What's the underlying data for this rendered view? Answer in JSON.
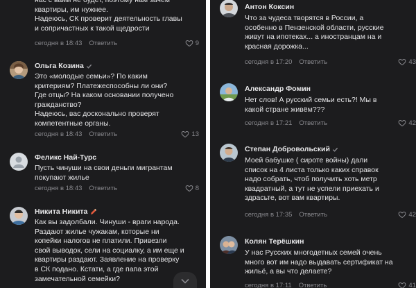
{
  "left": {
    "comments": [
      {
        "author": "",
        "text": "нас с вами не будет, поэтому нам зачем\nквартиры, им нужнее.\nНадеюсь, СК проверит деятельность главы\nи сопричастных к такой щедрости",
        "time": "сегодня в 18:43",
        "reply": "Ответить",
        "likes": "9"
      },
      {
        "author": "Ольга Козина",
        "text": "Это «молодые семьи»? По каким\nкритериям? Платежеспособны ли они?\nГде отцы? На каком основании получено\nгражданство?\nНадеюсь, вас досконально проверят\nкомпетентные органы.",
        "time": "сегодня в 18:43",
        "reply": "Ответить",
        "likes": "13"
      },
      {
        "author": "Феликс Най-Турс",
        "text": "Пусть чинуши на свои деньги мигрантам\nпокупают жилье",
        "time": "сегодня в 18:43",
        "reply": "Ответить",
        "likes": "8"
      },
      {
        "author": "Никита Никита",
        "text": "Как вы задолбали. Чинуши - враги народа.\nРаздают жилье чужакам, которые ни\nкопейки налогов не платили. Привезли\nсвой выводок, сели на социалку, а им еще и\nквартиры раздают. Заявление на проверку\nв СК подано. Кстати, а где папа этой\nзамечательной семейки?",
        "time": "",
        "reply": "",
        "likes": ""
      }
    ]
  },
  "right": {
    "comments": [
      {
        "author": "Антон Коксин",
        "text": "Что за чудеса творятся в России, а\nособенно в Пензенской области, русские\nживут на ипотеках... а иностранцам на и\nкрасная дорожка...",
        "time": "сегодня в 17:20",
        "reply": "Ответить",
        "likes": "43"
      },
      {
        "author": "Александр Фомин",
        "text": "Нет слов! А русский семьи есть?! Мы в\nкакой стране живём???",
        "time": "сегодня в 17:21",
        "reply": "Ответить",
        "likes": "42"
      },
      {
        "author": "Степан Добровольский",
        "text": "Моей бабушке ( сироте войны) дали\nсписок на 4 листа только каких справок\nнадо собрать,  чтоб получить хоть метр\nквадратный, а тут не успели приехать и\nздрасьте, вот вам квартиры.",
        "time": "сегодня в 17:35",
        "reply": "Ответить",
        "likes": "42"
      },
      {
        "author": "Колян Терёшкин",
        "text": "У нас Русских многодетных семей очень\nмного вот им надо выдавать сертификат на\nжильё, а вы что делаете?",
        "time": "сегодня в 17:11",
        "reply": "Ответить",
        "likes": "41"
      }
    ]
  },
  "colors": {
    "background": "#1c1c1e",
    "text": "#e3e3e5",
    "meta": "#8a8a8f",
    "divider": "#ffffff"
  },
  "icons": [
    "heart-icon",
    "verified-icon",
    "pencil-icon",
    "chevron-down-icon",
    "default-avatar-icon"
  ]
}
